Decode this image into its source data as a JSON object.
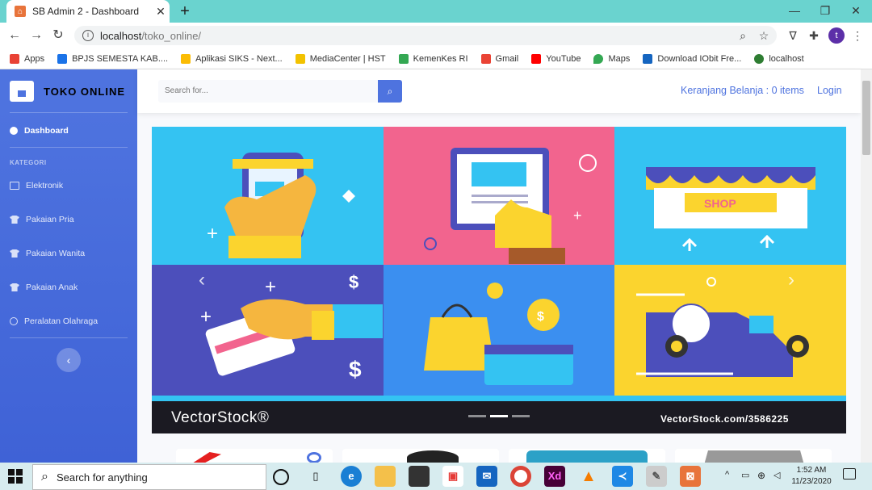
{
  "browser": {
    "tab_title": "SB Admin 2 - Dashboard",
    "tab_close": "✕",
    "new_tab": "+",
    "url_host": "localhost",
    "url_path": "/toko_online/",
    "avatar_letter": "t",
    "bookmarks": [
      {
        "label": "Apps",
        "color": "#e94235"
      },
      {
        "label": "BPJS SEMESTA KAB....",
        "color": "#1a73e8"
      },
      {
        "label": "Aplikasi SIKS - Next...",
        "color": "#fbbc04"
      },
      {
        "label": "MediaCenter | HST",
        "color": "#f2c200"
      },
      {
        "label": "KemenKes RI",
        "color": "#34a853"
      },
      {
        "label": "Gmail",
        "color": "#ea4335"
      },
      {
        "label": "YouTube",
        "color": "#ff0000"
      },
      {
        "label": "Maps",
        "color": "#34a853"
      },
      {
        "label": "Download IObit Fre...",
        "color": "#1565c0"
      },
      {
        "label": "localhost",
        "color": "#2e7d32"
      }
    ]
  },
  "sidebar": {
    "brand": "TOKO ONLINE",
    "dashboard": "Dashboard",
    "section": "KATEGORI",
    "items": [
      {
        "label": "Elektronik"
      },
      {
        "label": "Pakaian Pria"
      },
      {
        "label": "Pakaian Wanita"
      },
      {
        "label": "Pakaian Anak"
      },
      {
        "label": "Peralatan Olahraga"
      }
    ],
    "toggle": "‹"
  },
  "topbar": {
    "search_placeholder": "Search for...",
    "cart": "Keranjang Belanja : 0 items",
    "login": "Login"
  },
  "carousel": {
    "shop_sign": "SHOP",
    "logo": "VectorStock®",
    "url": "VectorStock.com/3586225",
    "prev": "‹",
    "next": "›",
    "active_index": 1,
    "colors": {
      "cyan": "#34c3f2",
      "pink": "#f2648e",
      "indigo": "#4c4fbb",
      "blue": "#3b8ff0",
      "yellow": "#fbd42e"
    }
  },
  "taskbar": {
    "search": "Search for anything",
    "time": "1:52 AM",
    "date": "11/23/2020",
    "xd": "Xd"
  }
}
